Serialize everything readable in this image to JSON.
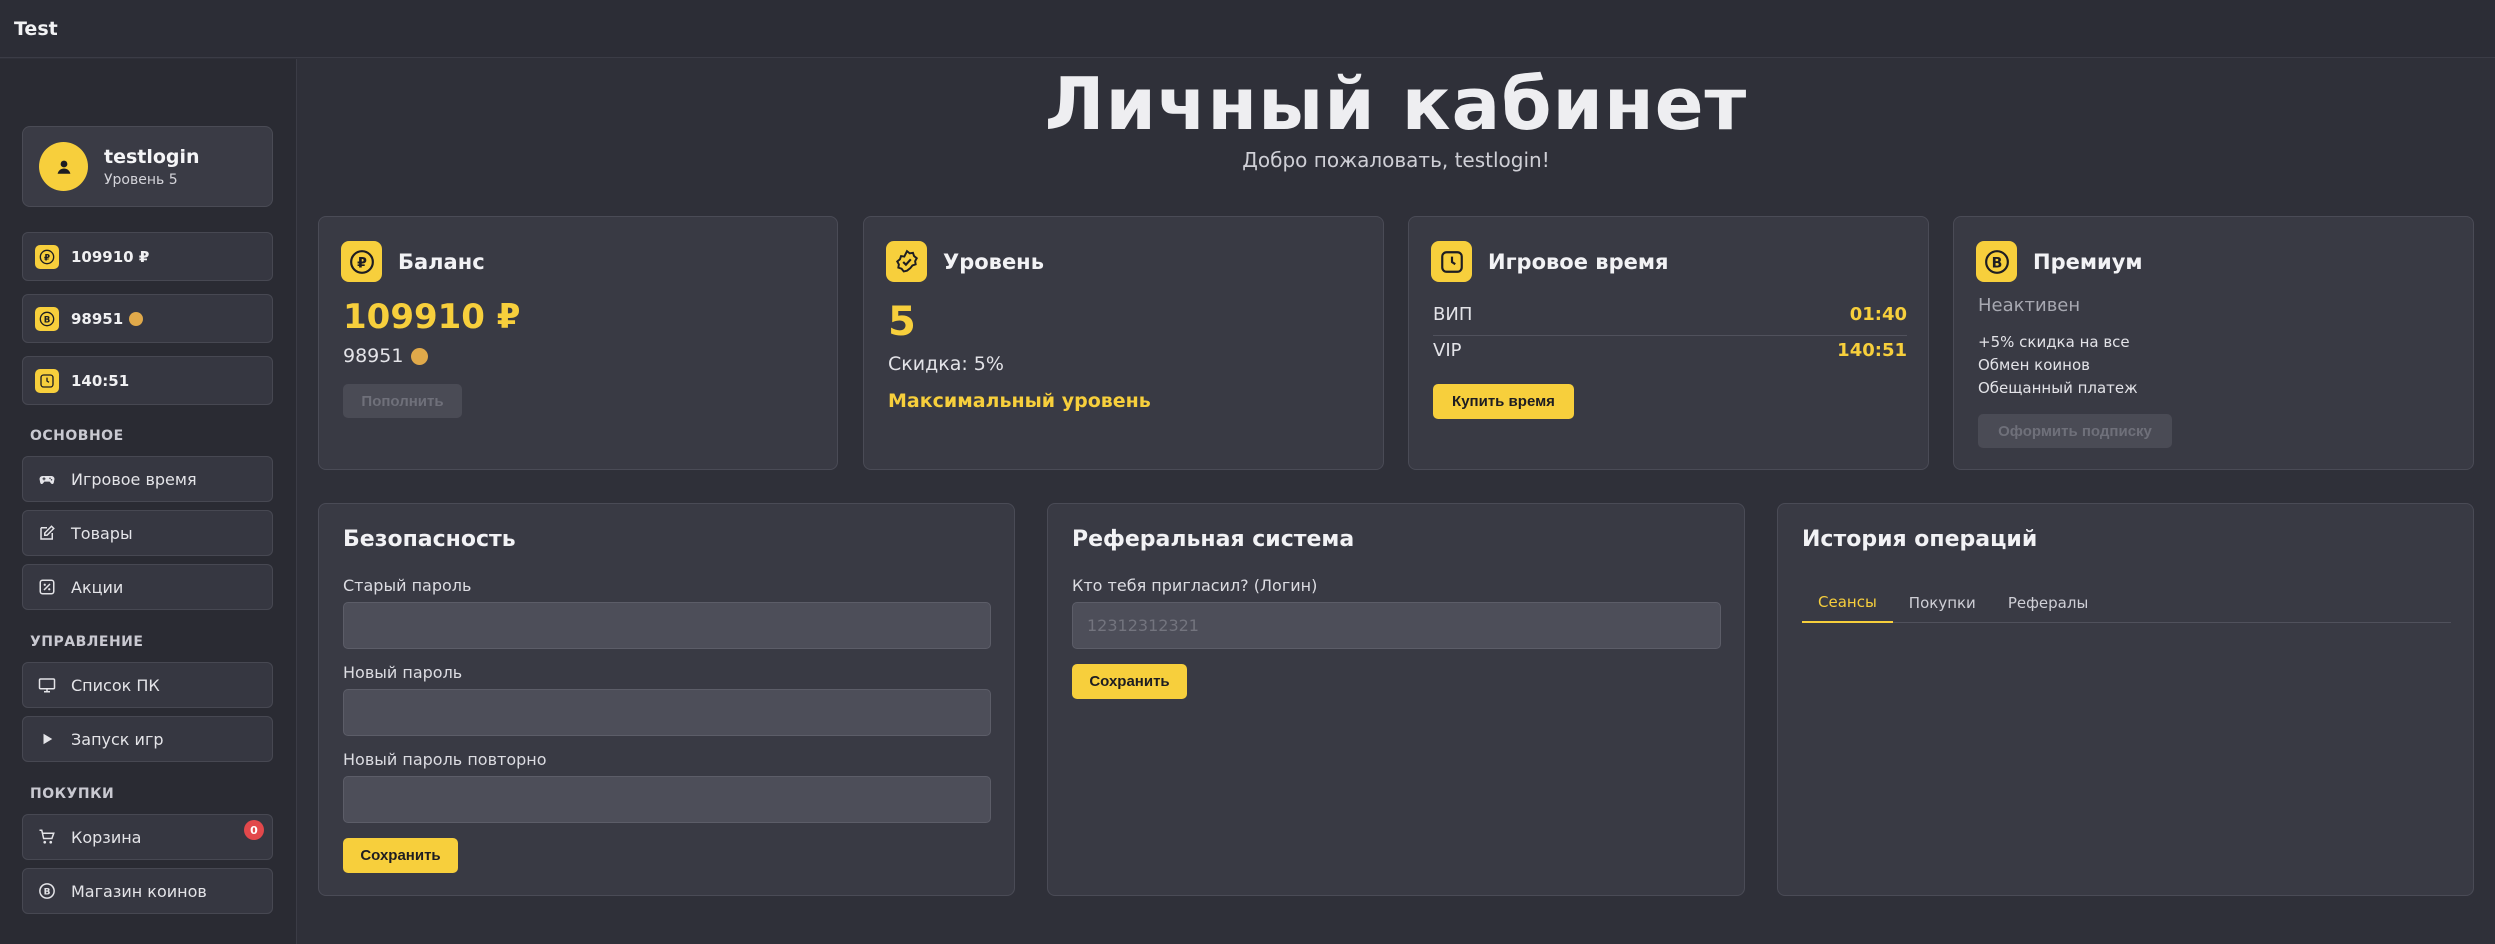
{
  "app": {
    "brand": "Test"
  },
  "user": {
    "name": "testlogin",
    "level": "Уровень 5"
  },
  "sidebar": {
    "stats": [
      {
        "value": "109910 ₽",
        "icon": "ruble-icon"
      },
      {
        "value": "98951",
        "icon": "coin-icon"
      },
      {
        "value": "140:51",
        "icon": "clock-icon"
      }
    ],
    "sections": {
      "main": "ОСНОВНОЕ",
      "manage": "УПРАВЛЕНИЕ",
      "purchases": "ПОКУПКИ"
    },
    "items": [
      {
        "label": "Игровое время",
        "icon": "gamepad-icon"
      },
      {
        "label": "Товары",
        "icon": "edit-icon"
      },
      {
        "label": "Акции",
        "icon": "percent-icon"
      },
      {
        "label": "Список ПК",
        "icon": "monitor-icon"
      },
      {
        "label": "Запуск игр",
        "icon": "play-icon"
      },
      {
        "label": "Корзина",
        "icon": "cart-icon",
        "badge": "0"
      },
      {
        "label": "Магазин коинов",
        "icon": "coin-shop-icon"
      }
    ]
  },
  "header": {
    "title": "Личный кабинет",
    "subtitle": "Добро пожаловать, testlogin!"
  },
  "cards": {
    "balance": {
      "title": "Баланс",
      "amount": "109910 ₽",
      "coins": "98951",
      "button": "Пополнить"
    },
    "level": {
      "title": "Уровень",
      "value": "5",
      "discount": "Скидка: 5%",
      "status": "Максимальный уровень"
    },
    "gametime": {
      "title": "Игровое время",
      "rows": [
        {
          "label": "ВИП",
          "value": "01:40"
        },
        {
          "label": "VIP",
          "value": "140:51"
        }
      ],
      "button": "Купить время"
    },
    "premium": {
      "title": "Премиум",
      "status": "Неактивен",
      "perks": [
        "+5% скидка на все",
        "Обмен коинов",
        "Обещанный платеж"
      ],
      "button": "Оформить подписку"
    }
  },
  "security": {
    "title": "Безопасность",
    "old_password_label": "Старый пароль",
    "new_password_label": "Новый пароль",
    "repeat_password_label": "Новый пароль повторно",
    "save_button": "Сохранить"
  },
  "referral": {
    "title": "Реферальная система",
    "question_label": "Кто тебя пригласил? (Логин)",
    "input_placeholder": "12312312321",
    "save_button": "Сохранить"
  },
  "history": {
    "title": "История операций",
    "tabs": [
      "Сеансы",
      "Покупки",
      "Рефералы"
    ]
  },
  "colors": {
    "accent": "#f7cf3c",
    "background": "#2f3039",
    "card": "#393a44",
    "badge": "#e2484b"
  }
}
